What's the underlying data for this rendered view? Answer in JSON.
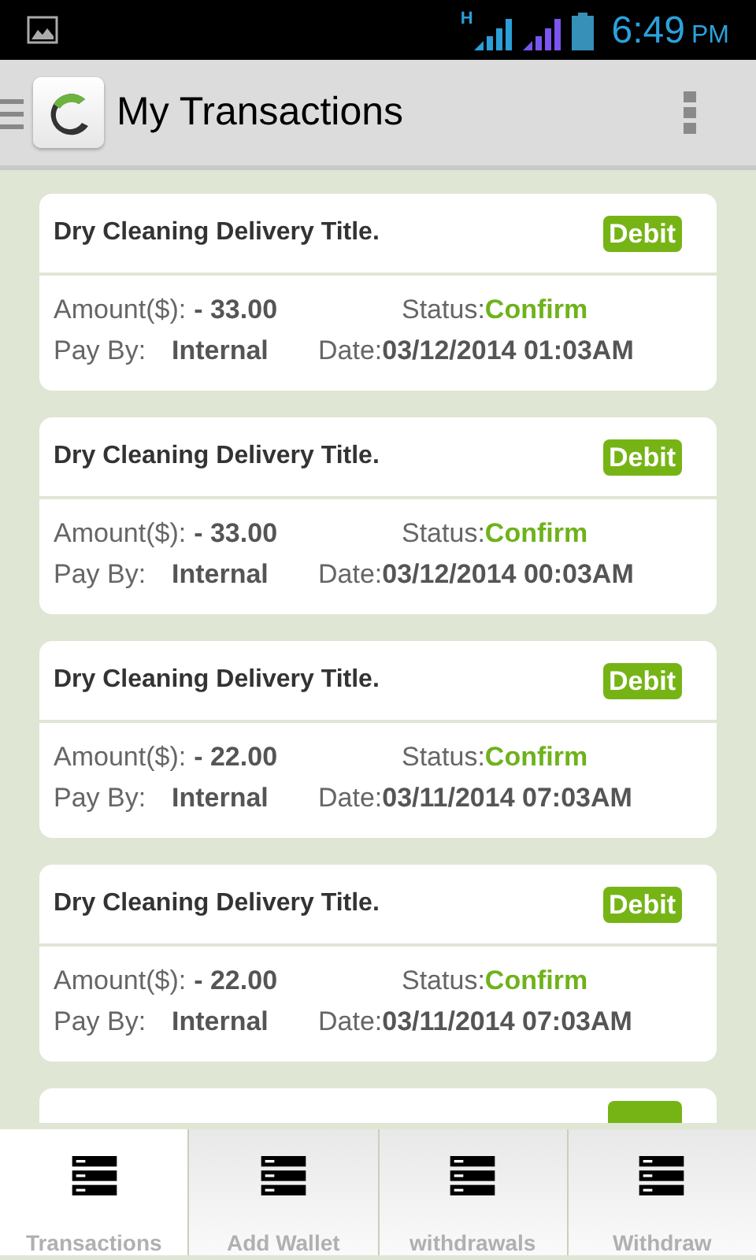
{
  "status_bar": {
    "time": "6:49",
    "ampm": "PM",
    "network_type": "H"
  },
  "action_bar": {
    "title": "My Transactions"
  },
  "transactions": [
    {
      "title": "Dry Cleaning Delivery Title.",
      "type": "Debit",
      "amount_label": "Amount($):",
      "amount": "- 33.00",
      "status_label": "Status:",
      "status": "Confirm",
      "pay_by_label": "Pay By:",
      "pay_by": "Internal",
      "date_label": "Date:",
      "date": "03/12/2014 01:03AM"
    },
    {
      "title": "Dry Cleaning Delivery Title.",
      "type": "Debit",
      "amount_label": "Amount($):",
      "amount": "- 33.00",
      "status_label": "Status:",
      "status": "Confirm",
      "pay_by_label": "Pay By:",
      "pay_by": "Internal",
      "date_label": "Date:",
      "date": "03/12/2014 00:03AM"
    },
    {
      "title": "Dry Cleaning Delivery Title.",
      "type": "Debit",
      "amount_label": "Amount($):",
      "amount": "- 22.00",
      "status_label": "Status:",
      "status": "Confirm",
      "pay_by_label": "Pay By:",
      "pay_by": "Internal",
      "date_label": "Date:",
      "date": "03/11/2014 07:03AM"
    },
    {
      "title": "Dry Cleaning Delivery Title.",
      "type": "Debit",
      "amount_label": "Amount($):",
      "amount": "- 22.00",
      "status_label": "Status:",
      "status": "Confirm",
      "pay_by_label": "Pay By:",
      "pay_by": "Internal",
      "date_label": "Date:",
      "date": "03/11/2014 07:03AM"
    }
  ],
  "more_below": true,
  "tabs": [
    {
      "label": "Transactions",
      "selected": true
    },
    {
      "label": "Add Wallet",
      "selected": false
    },
    {
      "label": "withdrawals",
      "selected": false
    },
    {
      "label": "Withdraw",
      "selected": false
    }
  ]
}
